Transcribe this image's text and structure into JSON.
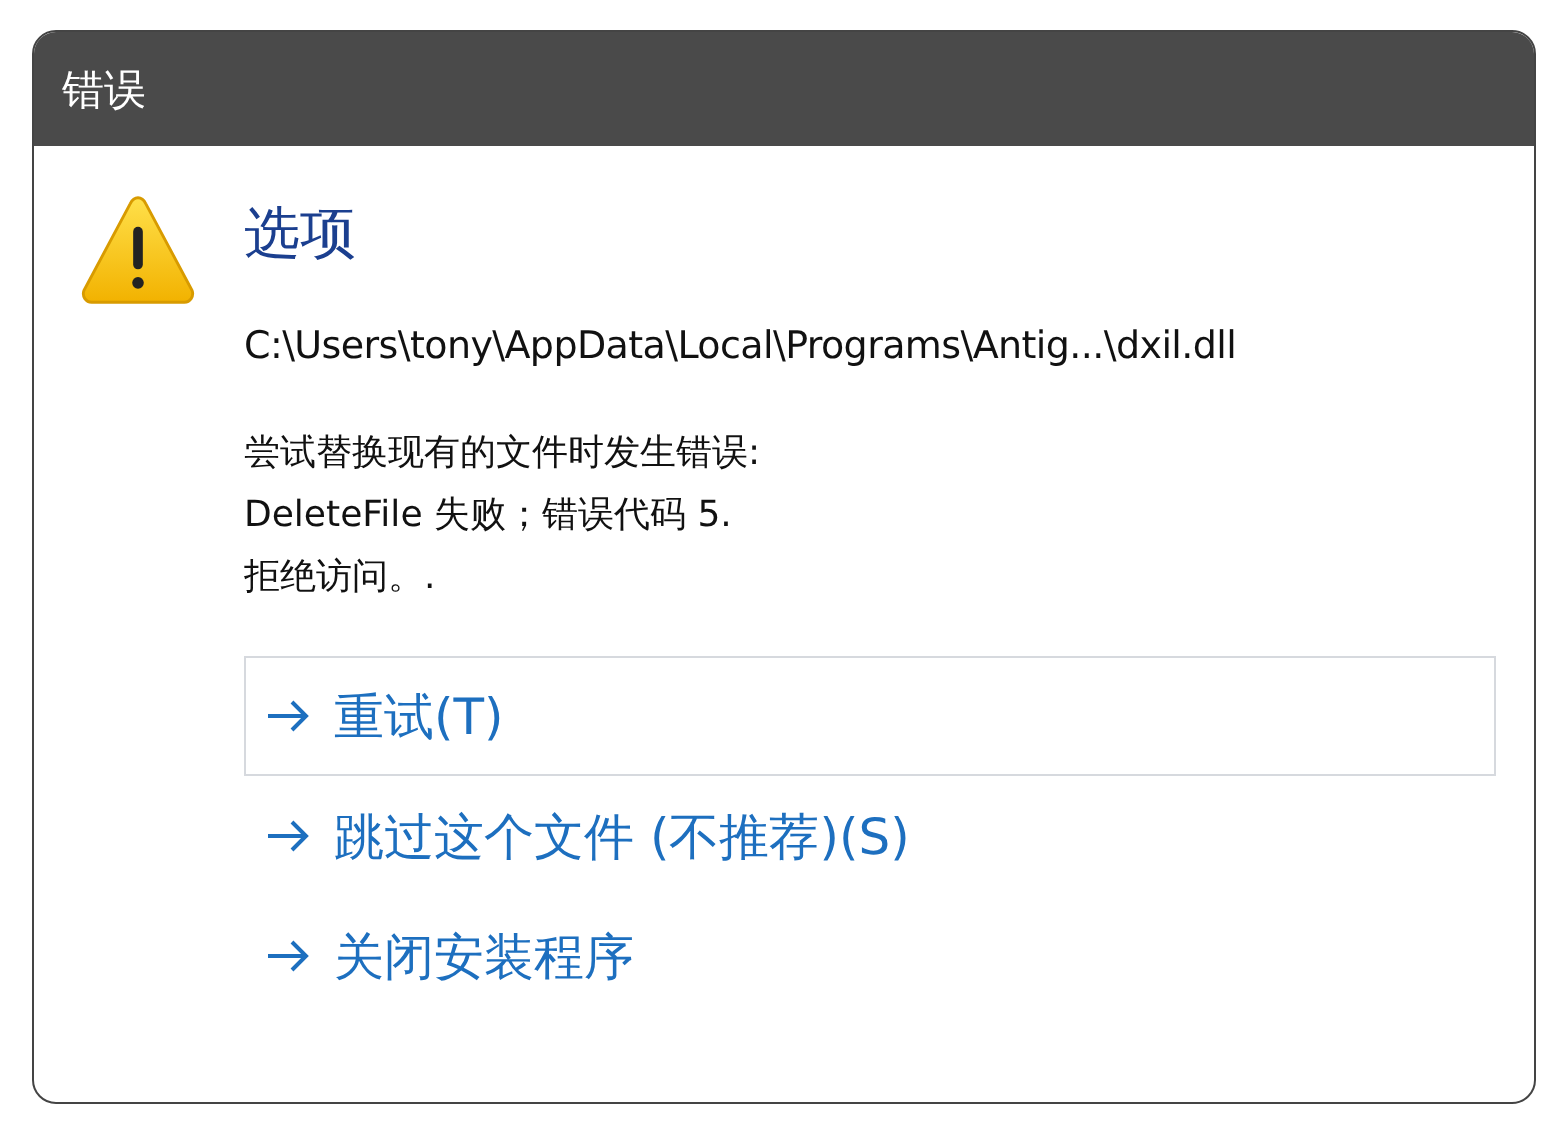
{
  "window": {
    "title": "错误"
  },
  "heading": "选项",
  "file_path": "C:\\Users\\tony\\AppData\\Local\\Programs\\Antig...\\dxil.dll",
  "message_lines": [
    "尝试替换现有的文件时发生错误:",
    "DeleteFile 失败；错误代码 5.",
    "拒绝访问。."
  ],
  "options": [
    {
      "label": "重试(T)",
      "selected": true
    },
    {
      "label": "跳过这个文件 (不推荐)(S)",
      "selected": false
    },
    {
      "label": "关闭安装程序",
      "selected": false
    }
  ]
}
